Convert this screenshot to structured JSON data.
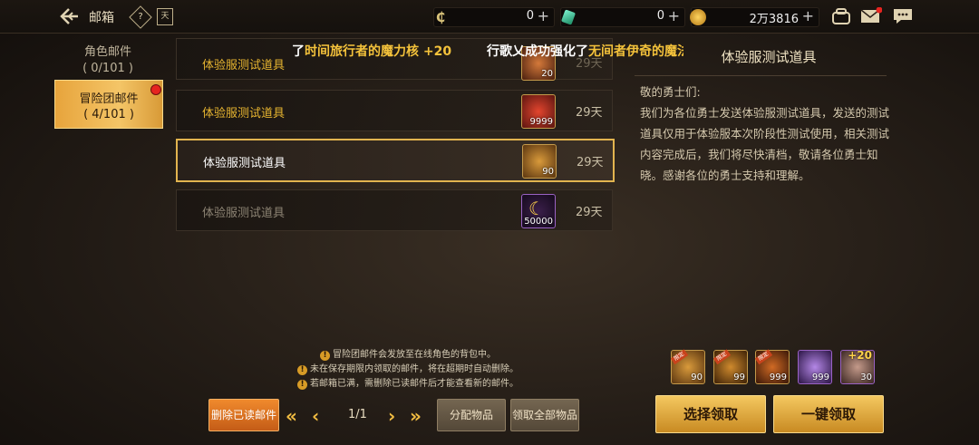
{
  "header": {
    "title": "邮箱",
    "help_icon": "?",
    "calendar_icon": "天",
    "currencies": [
      {
        "icon": "coin-c-icon",
        "value": "0"
      },
      {
        "icon": "green-crystal-icon",
        "value": "0"
      },
      {
        "icon": "gold-coin-icon",
        "value": "2万3816"
      }
    ]
  },
  "ticker": {
    "line1_prefix": "了",
    "line1_item": "时间旅行者的魔力核 +20",
    "line2_prefix": "行歌乂成功强化了",
    "line2_item": "无间者伊奇的魔法"
  },
  "tabs": [
    {
      "label": "角色邮件",
      "count": "( 0/101 )"
    },
    {
      "label": "冒险团邮件",
      "count": "( 4/101 )"
    }
  ],
  "mails": [
    {
      "subject": "体验服测试道具",
      "quantity": "20",
      "days": "29天"
    },
    {
      "subject": "体验服测试道具",
      "quantity": "9999",
      "days": "29天"
    },
    {
      "subject": "体验服测试道具",
      "quantity": "90",
      "days": "29天"
    },
    {
      "subject": "体验服测试道具",
      "quantity": "50000",
      "days": "29天"
    }
  ],
  "detail": {
    "title": "体验服测试道具",
    "greeting": "敬的勇士们:",
    "body": "我们为各位勇士发送体验服测试道具，发送的测试道具仅用于体验服本次阶段性测试使用，相关测试内容完成后，我们将尽快清档，敬请各位勇士知晓。感谢各位的勇士支持和理解。",
    "attachments": [
      {
        "quantity": "90",
        "tag": "限定"
      },
      {
        "quantity": "99",
        "tag": "限定"
      },
      {
        "quantity": "999",
        "tag": "限定"
      },
      {
        "quantity": "999",
        "tag": ""
      },
      {
        "quantity": "30",
        "tag": "",
        "enhance": "+20"
      }
    ]
  },
  "notices": [
    "冒险团邮件会发放至在线角色的背包中。",
    "未在保存期限内领取的邮件，将在超期时自动删除。",
    "若邮箱已满，需删除已读邮件后才能查看新的邮件。"
  ],
  "buttons": {
    "delete_read": "删除已读邮件",
    "page": "1/1",
    "distribute": "分配物品",
    "claim_all_items": "领取全部物品",
    "select_claim": "选择领取",
    "one_click_claim": "一键领取"
  }
}
